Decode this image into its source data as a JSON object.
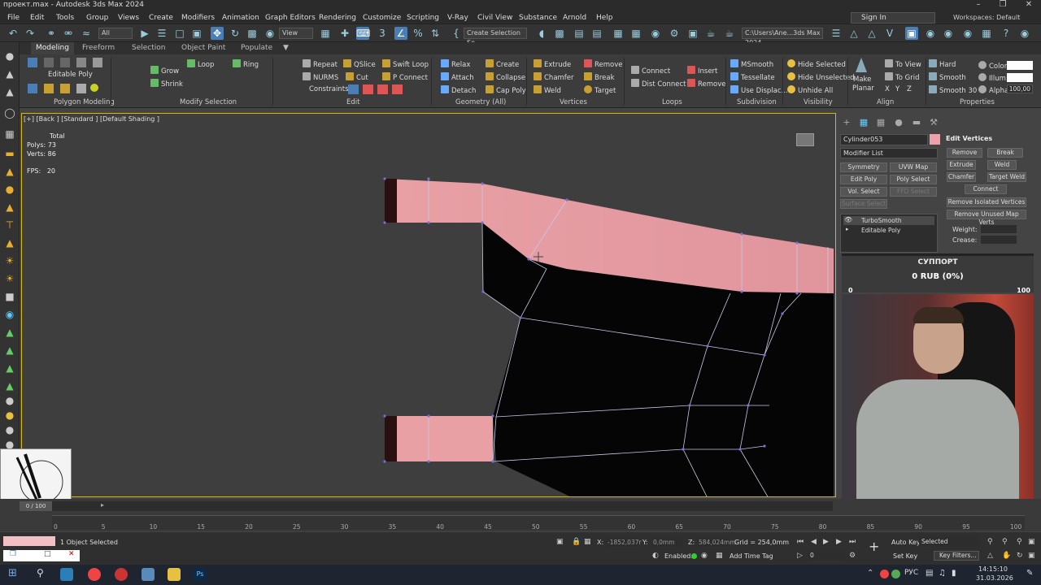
{
  "window": {
    "title": "проект.max - Autodesk 3ds Max 2024"
  },
  "menu": [
    "File",
    "Edit",
    "Tools",
    "Group",
    "Views",
    "Create",
    "Modifiers",
    "Animation",
    "Graph Editors",
    "Rendering",
    "Customize",
    "Scripting",
    "V-Ray",
    "Civil View",
    "Substance",
    "Arnold",
    "Help"
  ],
  "account": {
    "signin": "Sign In",
    "workspaces": "Workspaces: Default"
  },
  "toolbar": {
    "filter": "All",
    "view": "View",
    "selection_set": "Create Selection Se",
    "path": "C:\\Users\\Ane...3ds Max 2024"
  },
  "ribbon_tabs": [
    "Modeling",
    "Freeform",
    "Selection",
    "Object Paint",
    "Populate"
  ],
  "ribbon": {
    "editable_poly": "Editable Poly",
    "grow": "Grow",
    "shrink": "Shrink",
    "loop": "Loop",
    "ring": "Ring",
    "repeat": "Repeat",
    "qslice": "QSlice",
    "swift_loop": "Swift Loop",
    "nurms": "NURMS",
    "cut": "Cut",
    "p_connect": "P Connect",
    "constraints": "Constraints:",
    "relax": "Relax",
    "create": "Create",
    "attach": "Attach",
    "collapse": "Collapse",
    "detach": "Detach",
    "cap_poly": "Cap Poly",
    "extrude": "Extrude",
    "remove": "Remove",
    "chamfer": "Chamfer",
    "break": "Break",
    "weld": "Weld",
    "target": "Target",
    "connect": "Connect",
    "dist_connect": "Dist Connect",
    "insert": "Insert",
    "remove2": "Remove",
    "msmooth": "MSmooth",
    "tessellate": "Tessellate",
    "use_displac": "Use Displac...",
    "hide_selected": "Hide Selected",
    "hide_unselected": "Hide Unselected",
    "unhide_all": "Unhide All",
    "make": "Make",
    "planar": "Planar",
    "to_view": "To View",
    "to_grid": "To Grid",
    "x": "X",
    "y": "Y",
    "z": "Z",
    "hard": "Hard",
    "smooth": "Smooth",
    "smooth30": "Smooth 30",
    "color": "Color:",
    "illum": "Illum:",
    "alpha": "Alpha:",
    "alpha_val": "100,00",
    "panels": [
      "Polygon Modeling",
      "Modify Selection",
      "Edit",
      "Geometry (All)",
      "Vertices",
      "Loops",
      "Subdivision",
      "Visibility",
      "Align",
      "Properties"
    ]
  },
  "viewport": {
    "label": "[+] [Back ] [Standard ] [Default Shading ]",
    "stats_total": "Total",
    "polys_label": "Polys:",
    "polys": "73",
    "verts_label": "Verts:",
    "verts": "86",
    "fps_label": "FPS:",
    "fps": "20"
  },
  "command_panel": {
    "object_name": "Cylinder053",
    "modifier_list": "Modifier List",
    "mod_buttons": [
      "Symmetry",
      "UVW Map",
      "Edit Poly",
      "Poly Select",
      "Vol. Select",
      "FFD Select",
      "Surface Select"
    ],
    "stack": [
      "TurboSmooth",
      "Editable Poly"
    ],
    "edit_vertices": "Edit Vertices",
    "ev_remove": "Remove",
    "ev_break": "Break",
    "ev_extrude": "Extrude",
    "ev_weld": "Weld",
    "ev_chamfer": "Chamfer",
    "ev_target_weld": "Target Weld",
    "ev_connect": "Connect",
    "ev_remove_isolated": "Remove Isolated Vertices",
    "ev_remove_unused": "Remove Unused Map Verts",
    "weight": "Weight:",
    "crease": "Crease:"
  },
  "donation": {
    "title": "СУППОРТ",
    "amount": "0 RUB (0%)",
    "min": "0",
    "max": "100"
  },
  "timeline": {
    "frame": "0 / 100",
    "ticks": [
      "0",
      "5",
      "10",
      "15",
      "20",
      "25",
      "30",
      "35",
      "40",
      "45",
      "50",
      "55",
      "60",
      "65",
      "70",
      "75",
      "80",
      "85",
      "90",
      "95",
      "100"
    ]
  },
  "status": {
    "selected": "1 Object Selected",
    "x_label": "X:",
    "x": "-1852,037r",
    "y_label": "Y:",
    "y": "0,0mm",
    "z_label": "Z:",
    "z": "584,024mm",
    "grid": "Grid = 254,0mm",
    "enabled": "Enabled:",
    "add_time_tag": "Add Time Tag",
    "auto_key": "Auto Key",
    "set_key": "Set Key",
    "selected_dd": "Selected",
    "key_filters": "Key Filters...",
    "frame": "0"
  },
  "taskbar": {
    "lang": "РУС",
    "time": "14:15:10",
    "date": "31.03.2026"
  }
}
